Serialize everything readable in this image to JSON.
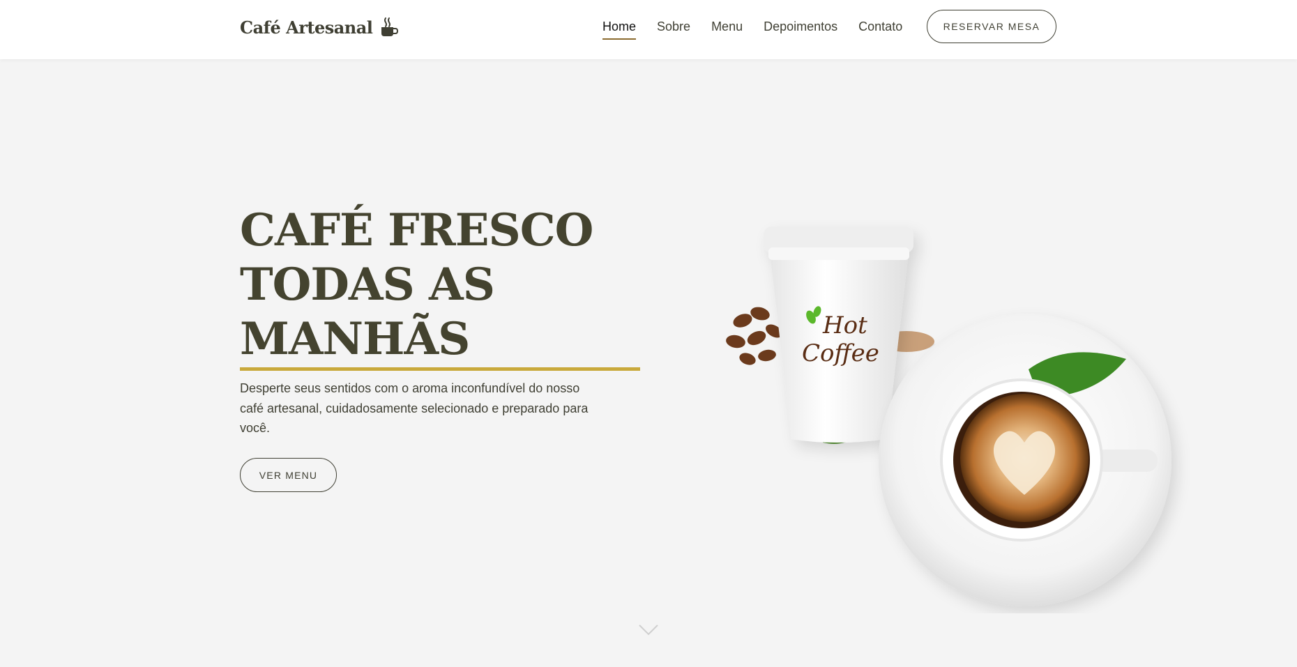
{
  "brand": {
    "name": "Café Artesanal",
    "icon": "coffee-cup-icon"
  },
  "nav": {
    "items": [
      {
        "label": "Home",
        "active": true
      },
      {
        "label": "Sobre",
        "active": false
      },
      {
        "label": "Menu",
        "active": false
      },
      {
        "label": "Depoimentos",
        "active": false
      },
      {
        "label": "Contato",
        "active": false
      }
    ],
    "reserve_label": "RESERVAR MESA"
  },
  "hero": {
    "title_lines": [
      "CAFÉ FRESCO",
      "TODAS AS",
      "MANHÃS"
    ],
    "description": "Desperte seus sentidos com o aroma inconfundível do nosso café artesanal, cuidadosamente selecionado e preparado para você.",
    "cta_label": "VER MENU",
    "cup_logo_line1": "Hot",
    "cup_logo_line2": "Coffee"
  },
  "colors": {
    "text": "#3f3f33",
    "accent_rule": "#c9a93b",
    "nav_underline": "#8b6a2e",
    "background": "#f4f4f4"
  },
  "icons": {
    "scroll": "chevron-down-icon"
  }
}
